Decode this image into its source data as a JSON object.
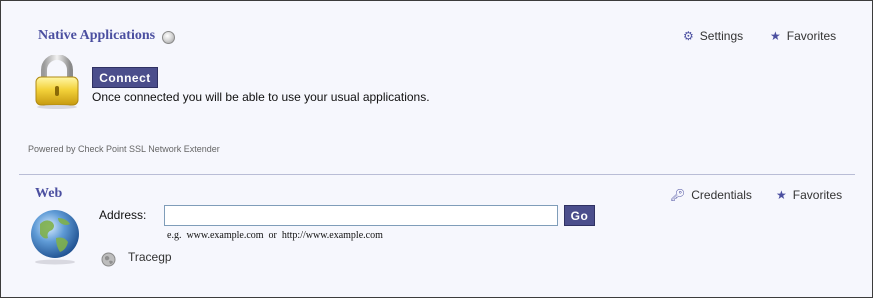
{
  "native": {
    "title": "Native Applications",
    "settings_label": "Settings",
    "favorites_label": "Favorites",
    "connect_label": "Connect",
    "message": "Once connected you will be able to use your usual applications.",
    "powered_by": "Powered by Check Point SSL Network Extender"
  },
  "web": {
    "title": "Web",
    "credentials_label": "Credentials",
    "favorites_label": "Favorites",
    "address_label": "Address:",
    "address_value": "",
    "go_label": "Go",
    "hint": "e.g.  www.example.com  or  http://www.example.com",
    "bookmarks": [
      {
        "label": "Tracegp",
        "icon": "globe-icon"
      }
    ]
  },
  "colors": {
    "accent": "#4b4fa0",
    "button_bg": "#4b4e8c",
    "panel_bg": "#f6f7fd"
  }
}
